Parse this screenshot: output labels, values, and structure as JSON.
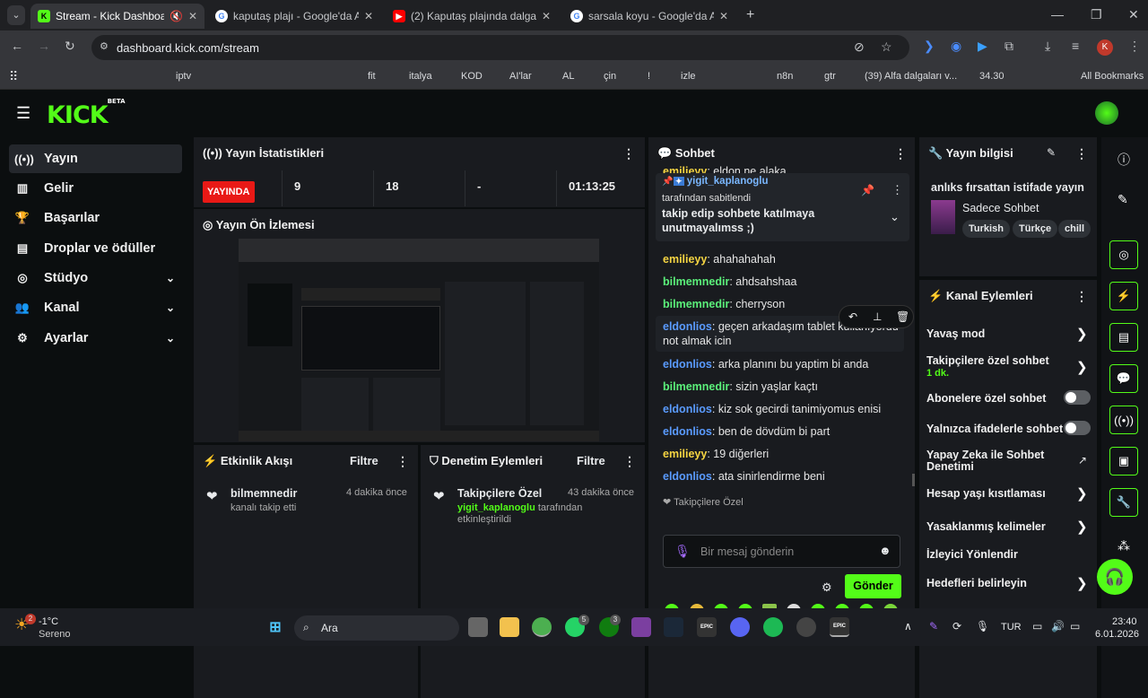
{
  "browser": {
    "tabs": [
      {
        "title": "Stream - Kick Dashboard",
        "active": true
      },
      {
        "title": "kaputaş plajı - Google'da Ara"
      },
      {
        "title": "(2) Kaputaş plajında dalgalar ba"
      },
      {
        "title": "sarsala koyu - Google'da Ara"
      }
    ],
    "url": "dashboard.kick.com/stream",
    "profile": "K",
    "bookmarks": [
      "iptv",
      "fit",
      "italya",
      "KOD",
      "AI'lar",
      "AL",
      "çin",
      "!",
      "izle",
      "n8n",
      "gtr",
      "(39) Alfa dalgaları v...",
      "34.30",
      "All Bookmarks"
    ]
  },
  "sidebar": {
    "logo": "KICK",
    "beta": "BETA",
    "items": [
      {
        "label": "Yayın",
        "icon": "broadcast-icon"
      },
      {
        "label": "Gelir",
        "icon": "chart-icon"
      },
      {
        "label": "Başarılar",
        "icon": "trophy-icon"
      },
      {
        "label": "Droplar ve ödüller",
        "icon": "gift-icon"
      },
      {
        "label": "Stüdyo",
        "icon": "camera-icon"
      },
      {
        "label": "Kanal",
        "icon": "users-icon"
      },
      {
        "label": "Ayarlar",
        "icon": "gear-icon"
      }
    ]
  },
  "stats": {
    "title": "Yayın İstatistikleri",
    "live": "YAYINDA",
    "viewers": "9",
    "followers": "18",
    "dash": "-",
    "time": "01:13:25"
  },
  "preview": {
    "title": "Yayın Ön İzlemesi"
  },
  "activity": {
    "title": "Etkinlik Akışı",
    "filter": "Filtre",
    "user": "bilmemnedir",
    "time": "4 dakika önce",
    "text": "kanalı takip etti"
  },
  "mod": {
    "title": "Denetim Eylemleri",
    "filter": "Filtre",
    "action": "Takipçilere Özel",
    "time": "43 dakika önce",
    "user": "yigit_kaplanoglu",
    "by": "tarafından",
    "enabled": "etkinleştirildi"
  },
  "chat": {
    "title": "Sohbet",
    "pinned": {
      "user": "yigit_kaplanoglu",
      "label": "tarafından sabitlendi",
      "text": "takip edip sohbete katılmaya unutmayalımss ;)"
    },
    "messages": [
      {
        "user": "emilieyy",
        "text": "eldon ne alaka"
      },
      {
        "user": "emilieyy",
        "text": "ahahahahah"
      },
      {
        "user": "bilmemnedir",
        "text": "ahdsahshaa"
      },
      {
        "user": "bilmemnedir",
        "text": "cherryson"
      },
      {
        "user": "eldonlios",
        "text": "geçen arkadaşım tablet kullanıyordu not almak icin"
      },
      {
        "user": "eldonlios",
        "text": "arka planını bu yaptim bi anda"
      },
      {
        "user": "bilmemnedir",
        "text": "sizin yaşlar kaçtı"
      },
      {
        "user": "eldonlios",
        "text": "kiz sok gecirdi tanimiyomus enisi"
      },
      {
        "user": "eldonlios",
        "text": "ben de dövdüm bi part"
      },
      {
        "user": "emilieyy",
        "text": "19 diğerleri"
      },
      {
        "user": "eldonlios",
        "text": "ata sinirlendirme beni"
      }
    ],
    "mode": "Takipçilere Özel",
    "placeholder": "Bir mesaj gönderin",
    "send": "Gönder"
  },
  "info": {
    "title": "Yayın bilgisi",
    "stream_title": "anlıks fırsattan istifade yayın",
    "category": "Sadece Sohbet",
    "tags": [
      "Turkish",
      "Türkçe",
      "chill"
    ]
  },
  "channel": {
    "title": "Kanal Eylemleri",
    "items": [
      {
        "label": "Yavaş mod"
      },
      {
        "label": "Takipçilere özel sohbet",
        "sub": "1 dk."
      },
      {
        "label": "Abonelere özel sohbet"
      },
      {
        "label": "Yalnızca ifadelerle sohbet"
      },
      {
        "label": "Yapay Zeka ile Sohbet Denetimi"
      },
      {
        "label": "Hesap yaşı kısıtlaması"
      },
      {
        "label": "Yasaklanmış kelimeler"
      },
      {
        "label": "İzleyici Yönlendir"
      },
      {
        "label": "Hedefleri belirleyin"
      }
    ]
  },
  "taskbar": {
    "temp": "-1°C",
    "weather": "Sereno",
    "search": "Ara",
    "lang": "TUR",
    "time": "23:40",
    "date": "6.01.2026",
    "badges": [
      "2",
      "5",
      "3"
    ]
  }
}
